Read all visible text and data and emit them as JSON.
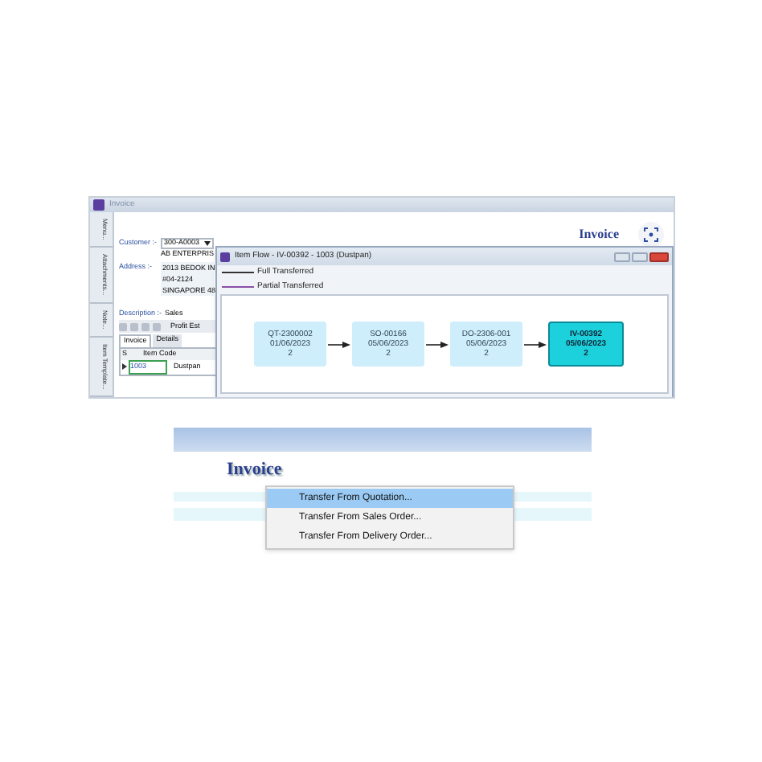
{
  "invoice_window": {
    "title": "Invoice",
    "side_tabs": [
      "Menu...",
      "Attachments...",
      "Note...",
      "Item Template..."
    ],
    "customer_label": "Customer :-",
    "customer_code": "300-A0003",
    "customer_name": "AB ENTERPRIS",
    "address_label": "Address :-",
    "address_lines": [
      "2013 BEDOK IN",
      "#04-2124",
      "SINGAPORE 48"
    ],
    "description_label": "Description :-",
    "description": "Sales",
    "toolbar_button": "Profit Est",
    "tabs": [
      {
        "label": "Invoice",
        "selected": true
      },
      {
        "label": "Details",
        "selected": false
      }
    ],
    "grid": {
      "columns": [
        "S",
        "Item Code"
      ],
      "rows": [
        {
          "item_code": "1003",
          "description": "Dustpan"
        }
      ]
    },
    "heading": "Invoice"
  },
  "item_flow": {
    "title": "Item Flow - IV-00392 - 1003 (Dustpan)",
    "legend": [
      {
        "label": "Full Transferred",
        "color": "#333333"
      },
      {
        "label": "Partial Transferred",
        "color": "#8a4fa8"
      }
    ],
    "nodes": [
      {
        "number": "QT-2300002",
        "date": "01/06/2023",
        "qty": "2",
        "selected": false
      },
      {
        "number": "SO-00166",
        "date": "05/06/2023",
        "qty": "2",
        "selected": false
      },
      {
        "number": "DO-2306-001",
        "date": "05/06/2023",
        "qty": "2",
        "selected": false
      },
      {
        "number": "IV-00392",
        "date": "05/06/2023",
        "qty": "2",
        "selected": true
      }
    ]
  },
  "transfer_screen": {
    "heading": "Invoice",
    "menu": [
      {
        "label": "Transfer From Quotation...",
        "selected": true
      },
      {
        "label": "Transfer From Sales Order...",
        "selected": false
      },
      {
        "label": "Transfer From Delivery Order...",
        "selected": false
      }
    ]
  }
}
